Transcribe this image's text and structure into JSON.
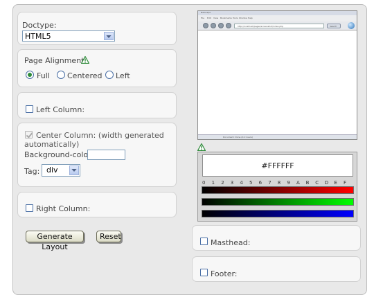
{
  "left": {
    "doctype": {
      "label": "Doctype:",
      "value": "HTML5"
    },
    "alignment": {
      "label": "Page Alignment:",
      "options": [
        "Full",
        "Centered",
        "Left"
      ],
      "selected": "Full"
    },
    "left_column": {
      "label": "Left Column:"
    },
    "center_column": {
      "label_line1": "Center Column: (width generated",
      "label_line2": "automatically)",
      "bgcolor_label": "Background-color:",
      "bgcolor_value": "",
      "tag_label": "Tag:",
      "tag_value": "div"
    },
    "right_column": {
      "label": "Right Column:"
    },
    "buttons": {
      "generate": "Generate Layout",
      "reset": "Reset"
    }
  },
  "right": {
    "preview": {
      "browser_title": "Netscape",
      "menu_items": [
        "File",
        "Edit",
        "View",
        "Bookmarks",
        "Tools",
        "Window",
        "Help"
      ],
      "url": "http://localhost/pages/screenshot/index.php",
      "go_label": "Search",
      "status_text": "Document: Done (0.11 secs)"
    },
    "color_picker": {
      "value": "#FFFFFF",
      "hex_digits": [
        "0",
        "1",
        "2",
        "3",
        "4",
        "5",
        "6",
        "7",
        "8",
        "9",
        "A",
        "B",
        "C",
        "D",
        "E",
        "F"
      ],
      "channels": [
        {
          "name": "red",
          "color": "#ff0000"
        },
        {
          "name": "green",
          "color": "#00ff00"
        },
        {
          "name": "blue",
          "color": "#0000ff"
        }
      ]
    },
    "masthead": {
      "label": "Masthead:"
    },
    "footer": {
      "label": "Footer:"
    }
  },
  "colors": {
    "warning": "#2e8b3a",
    "accent": "#4a6fa5"
  }
}
